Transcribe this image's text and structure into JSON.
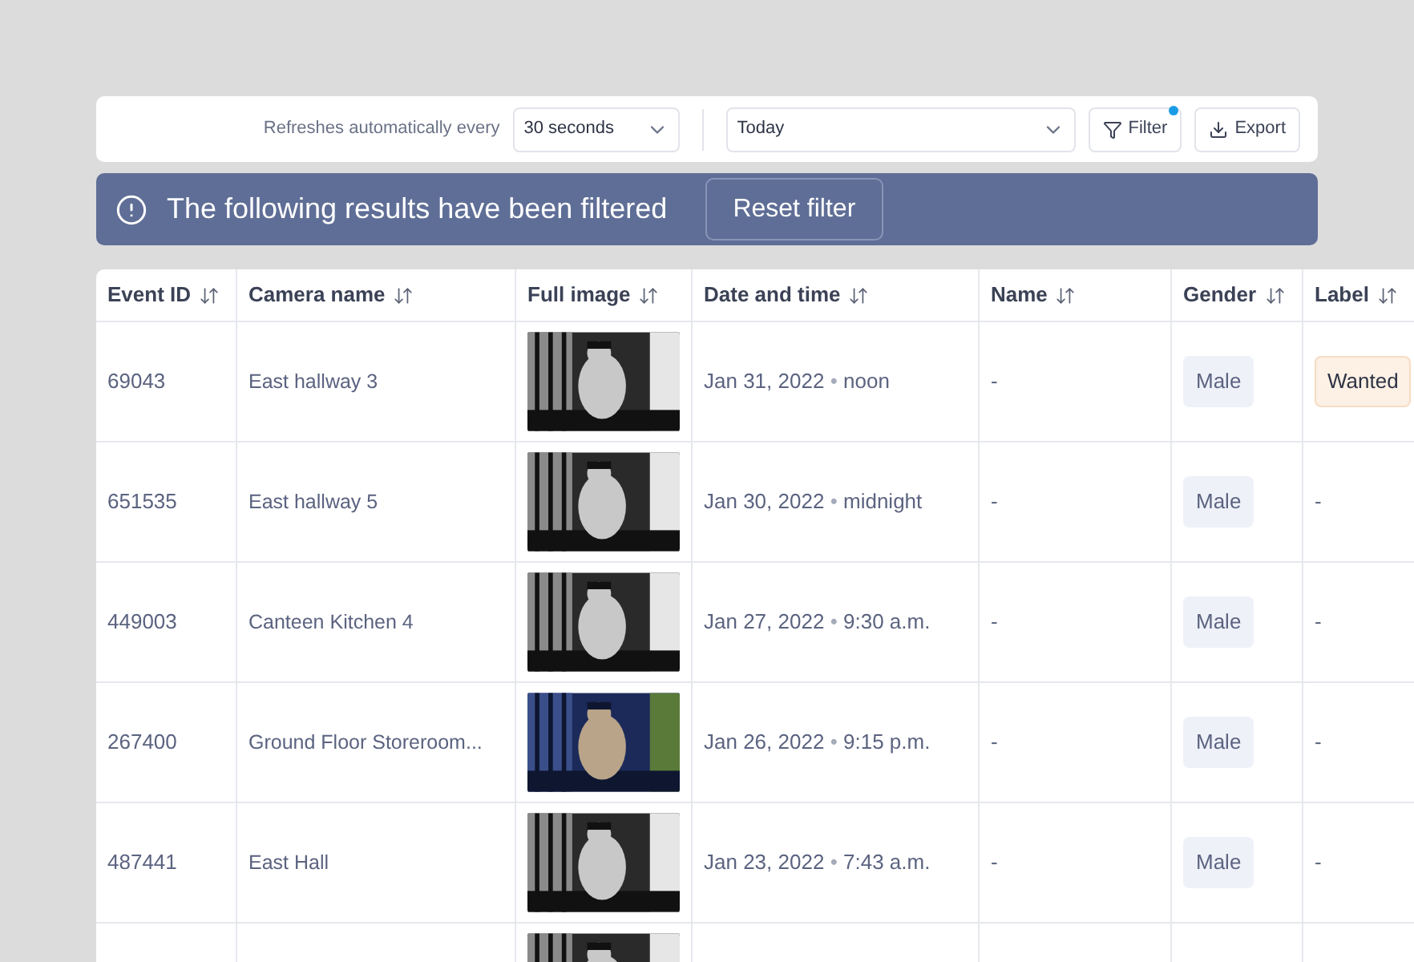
{
  "toolbar": {
    "refresh_label": "Refreshes automatically every",
    "refresh_interval": "30 seconds",
    "date_range": "Today",
    "filter_button": "Filter",
    "filter_active": true,
    "export_button": "Export"
  },
  "banner": {
    "message": "The following results have been filtered",
    "reset_button": "Reset filter"
  },
  "table": {
    "columns": [
      "Event ID",
      "Camera name",
      "Full image",
      "Date and time",
      "Name",
      "Gender",
      "Label"
    ],
    "rows": [
      {
        "event_id": "69043",
        "camera": "East hallway 3",
        "date": "Jan 31, 2022",
        "separator": "•",
        "time": "noon",
        "name": "-",
        "gender": "Male",
        "label": {
          "kind": "tag",
          "text": "Wanted"
        }
      },
      {
        "event_id": "651535",
        "camera": "East hallway 5",
        "date": "Jan 30, 2022",
        "separator": "•",
        "time": "midnight",
        "name": "-",
        "gender": "Male",
        "label": {
          "kind": "plain",
          "text": "-"
        }
      },
      {
        "event_id": "449003",
        "camera": "Canteen Kitchen 4",
        "date": "Jan 27, 2022",
        "separator": "•",
        "time": "9:30 a.m.",
        "name": "-",
        "gender": "Male",
        "label": {
          "kind": "plain",
          "text": "-"
        }
      },
      {
        "event_id": "267400",
        "camera": "Ground Floor Storeroom...",
        "date": "Jan 26, 2022",
        "separator": "•",
        "time": "9:15 p.m.",
        "name": "-",
        "gender": "Male",
        "label": {
          "kind": "plain",
          "text": "-"
        }
      },
      {
        "event_id": "487441",
        "camera": "East Hall",
        "date": "Jan 23, 2022",
        "separator": "•",
        "time": "7:43 a.m.",
        "name": "-",
        "gender": "Male",
        "label": {
          "kind": "plain",
          "text": "-"
        }
      }
    ]
  }
}
